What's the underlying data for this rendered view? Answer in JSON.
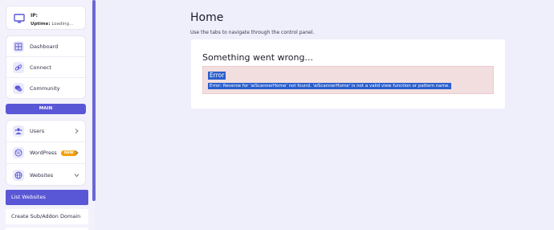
{
  "ip_card": {
    "ip_label": "IP:",
    "uptime_label": "Uptime:",
    "uptime_value": "Loading..."
  },
  "nav_top": [
    {
      "label": "Dashboard",
      "icon": "grid-icon"
    },
    {
      "label": "Connect",
      "icon": "link-icon"
    },
    {
      "label": "Community",
      "icon": "chat-icon"
    }
  ],
  "section_label": "MAIN",
  "nav_main": [
    {
      "label": "Users",
      "icon": "users-icon",
      "chevron": "right"
    },
    {
      "label": "WordPress",
      "icon": "wordpress-icon",
      "chevron": "right",
      "badge": "NEW"
    },
    {
      "label": "Websites",
      "icon": "globe-icon",
      "chevron": "down"
    }
  ],
  "submenu": {
    "active": "List Websites",
    "next": "Create Sub/Addon Domain"
  },
  "page": {
    "title": "Home",
    "subtitle": "Use the tabs to navigate through the control panel."
  },
  "error": {
    "heading": "Something went wrong...",
    "label": "Error",
    "message": "Error: Reverse for 'aiScannerHome' not found. 'aiScannerHome' is not a valid view function or pattern name."
  },
  "colors": {
    "accent": "#5a57d6",
    "badge": "#f5a000",
    "error_bg": "#f2dede",
    "selection": "#2b5fcc"
  }
}
